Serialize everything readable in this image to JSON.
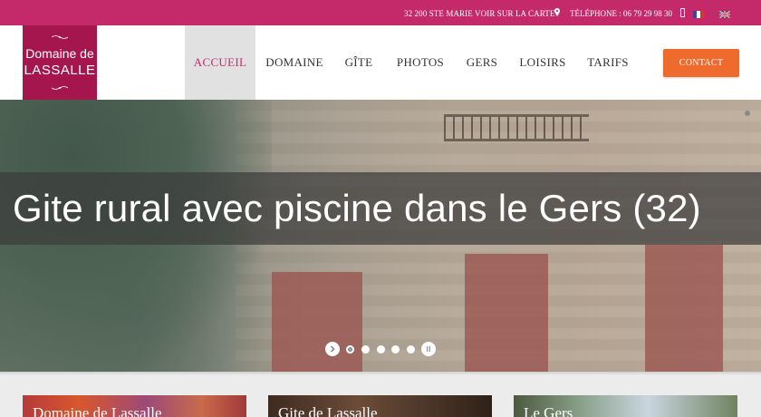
{
  "topbar": {
    "address": "32 200 STE MARIE VOIR SUR LA CARTE",
    "phone": "TÉLÉPHONE : 06 79 29 98 30",
    "icons": [
      "map-pin-icon",
      "mobile-phone-icon",
      "flag-fr-icon",
      "flag-uk-icon"
    ],
    "background": "#c42a6a"
  },
  "logo": {
    "line1": "Domaine de",
    "line2": "LASSALLE",
    "background": "#a5164f"
  },
  "nav": {
    "items": [
      {
        "label": "ACCUEIL",
        "active": true
      },
      {
        "label": "DOMAINE",
        "active": false
      },
      {
        "label": "GÎTE",
        "active": false
      },
      {
        "label": "PHOTOS",
        "active": false
      },
      {
        "label": "GERS",
        "active": false
      },
      {
        "label": "LOISIRS",
        "active": false
      },
      {
        "label": "TARIFS",
        "active": false
      }
    ],
    "active_color": "#c42a6a",
    "contact_label": "CONTACT",
    "contact_color": "#ef6a2d"
  },
  "hero": {
    "caption": "Gite rural avec piscine dans le Gers (32)",
    "slide_count": 5,
    "active_slide": 1,
    "controls": [
      "next-arrow-icon",
      "pause-icon"
    ]
  },
  "cards": [
    {
      "title": "Domaine de Lassalle"
    },
    {
      "title": "Gite de Lassalle"
    },
    {
      "title": "Le Gers"
    }
  ]
}
